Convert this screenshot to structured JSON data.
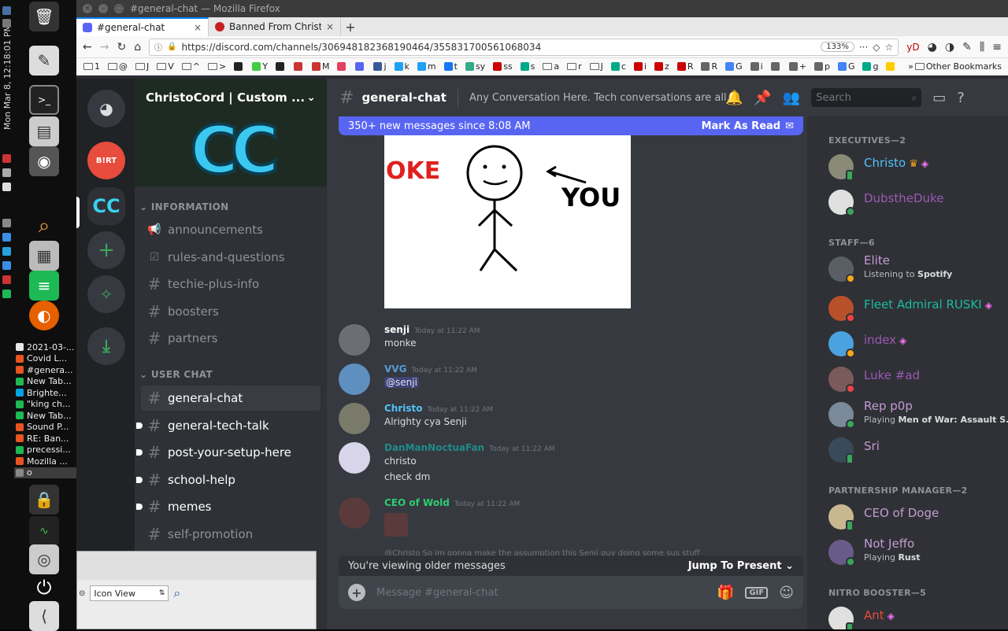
{
  "os": {
    "clock": "Mon Mar 8, 12:18:01 PM",
    "tasks": [
      {
        "label": "2021-03-...",
        "color": "#e8e8e8"
      },
      {
        "label": "Covid L...",
        "color": "#e95420"
      },
      {
        "label": "#genera...",
        "color": "#e95420"
      },
      {
        "label": "New Tab...",
        "color": "#1db954"
      },
      {
        "label": "Brighte...",
        "color": "#00a3e0"
      },
      {
        "label": "\"king ch...",
        "color": "#1db954"
      },
      {
        "label": "New Tab...",
        "color": "#1db954"
      },
      {
        "label": "Sound P...",
        "color": "#e95420"
      },
      {
        "label": "RE: Ban...",
        "color": "#e95420"
      },
      {
        "label": "precessi...",
        "color": "#1db954"
      },
      {
        "label": "Mozilla ...",
        "color": "#e95420"
      },
      {
        "label": "o",
        "color": "#888888"
      }
    ]
  },
  "firefox": {
    "title": "#general-chat — Mozilla Firefox",
    "tabs": [
      {
        "label": "#general-chat",
        "close": "×"
      },
      {
        "label": "Banned From ChristoCo",
        "close": "×"
      }
    ],
    "new_tab": "+",
    "url": "https://discord.com/channels/306948182368190464/355831700561068034",
    "zoom": "133%",
    "bookmarks": [
      "1",
      "@",
      "J",
      "V",
      "^",
      ">",
      "",
      "Y",
      "",
      "",
      "M",
      "",
      "",
      "j",
      "k",
      "m",
      "t",
      "sy",
      "ss",
      "s",
      "a",
      "r",
      "J",
      "c",
      "i",
      "z",
      "R",
      "R",
      "G",
      "i",
      "",
      "+",
      "p",
      "G",
      "g",
      ""
    ],
    "other_bookmarks": "Other Bookmarks"
  },
  "discord": {
    "server_name": "ChristoCord | Custom ...",
    "categories": {
      "information": "INFORMATION",
      "user_chat": "USER CHAT"
    },
    "info_channels": [
      {
        "name": "announcements",
        "icon": "megaphone-icon"
      },
      {
        "name": "rules-and-questions",
        "icon": "checkbox-icon"
      },
      {
        "name": "techie-plus-info",
        "icon": "hash-icon"
      },
      {
        "name": "boosters",
        "icon": "hash-icon"
      },
      {
        "name": "partners",
        "icon": "hash-icon"
      }
    ],
    "chat_channels": [
      {
        "name": "general-chat",
        "selected": true,
        "unread": false
      },
      {
        "name": "general-tech-talk",
        "selected": false,
        "unread": true
      },
      {
        "name": "post-your-setup-here",
        "selected": false,
        "unread": true
      },
      {
        "name": "school-help",
        "selected": false,
        "unread": true
      },
      {
        "name": "memes",
        "selected": false,
        "unread": true
      },
      {
        "name": "self-promotion",
        "selected": false,
        "unread": false
      }
    ],
    "channel": {
      "name": "general-chat",
      "topic": "Any Conversation Here. Tech conversations are all...",
      "search_placeholder": "Search"
    },
    "new_messages_bar": {
      "text": "350+ new messages since 8:08 AM",
      "action": "Mark As Read"
    },
    "meme": {
      "left_text": "OKE",
      "right_text": "YOU"
    },
    "messages": [
      {
        "user": "senji",
        "time": "Today at 11:22 AM",
        "lines": [
          "monke"
        ],
        "color": "#ffffff",
        "avatar": "#6b6f74"
      },
      {
        "user": "VVG",
        "time": "Today at 11:22 AM",
        "lines": [
          "@senji"
        ],
        "color": "#5b9bd5",
        "avatar": "#5f8fbf"
      },
      {
        "user": "Christo",
        "time": "Today at 11:22 AM",
        "lines": [
          "Alrighty cya Senji"
        ],
        "color": "#4fc3f7",
        "avatar": "#7a7a6a"
      },
      {
        "user": "DanManNoctuaFan",
        "time": "Today at 11:22 AM",
        "lines": [
          "christo",
          "check dm"
        ],
        "color": "#1f8b8b",
        "avatar": "#d8d4ea"
      },
      {
        "user": "CEO of Wold",
        "time": "Today at 11:22 AM",
        "lines": [
          ""
        ],
        "color": "#2ecc71",
        "avatar": "#5a3a3a"
      }
    ],
    "reply_preview": "@Christo So im gonna make the assumption this Senji guy doing some sus stuff",
    "older_bar": {
      "text": "You're viewing older messages",
      "action": "Jump To Present"
    },
    "composer_placeholder": "Message #general-chat",
    "member_groups": [
      {
        "title": "EXECUTIVES—2",
        "members": [
          {
            "name": "Christo",
            "color": "#4fc3f7",
            "badge": "crown+boost",
            "status": "mobile",
            "activity": "",
            "activity_bold": "",
            "avatar": "#8a8a78"
          },
          {
            "name": "DubstheDuke",
            "color": "#9b59b6",
            "badge": "",
            "status": "online",
            "activity": "",
            "activity_bold": "",
            "avatar": "#e0e0e0"
          }
        ]
      },
      {
        "title": "STAFF—6",
        "members": [
          {
            "name": "Elite",
            "color": "#c39bd3",
            "badge": "",
            "status": "idle",
            "activity": "Listening to ",
            "activity_bold": "Spotify",
            "avatar": "#5a5f66"
          },
          {
            "name": "Fleet Admiral RUSKI",
            "color": "#1abc9c",
            "badge": "boost",
            "status": "dnd",
            "activity": "",
            "activity_bold": "",
            "avatar": "#b8502a"
          },
          {
            "name": "index",
            "color": "#9b59b6",
            "badge": "boost",
            "status": "idle",
            "activity": "",
            "activity_bold": "",
            "avatar": "#4aa3df"
          },
          {
            "name": "Luke #ad",
            "color": "#9b59b6",
            "badge": "",
            "status": "dnd",
            "activity": "",
            "activity_bold": "",
            "avatar": "#7a5a5a"
          },
          {
            "name": "Rep p0p",
            "color": "#c39bd3",
            "badge": "",
            "status": "online",
            "activity": "Playing ",
            "activity_bold": "Men of War: Assault S...",
            "avatar": "#7a8a9a"
          },
          {
            "name": "Sri",
            "color": "#c39bd3",
            "badge": "",
            "status": "mobile",
            "activity": "",
            "activity_bold": "",
            "avatar": "#3a4a5a"
          }
        ]
      },
      {
        "title": "PARTNERSHIP MANAGER—2",
        "members": [
          {
            "name": "CEO of Doge",
            "color": "#c39bd3",
            "badge": "",
            "status": "mobile",
            "activity": "",
            "activity_bold": "",
            "avatar": "#c8b890"
          },
          {
            "name": "Not Jeffo",
            "color": "#c39bd3",
            "badge": "",
            "status": "online",
            "activity": "Playing ",
            "activity_bold": "Rust",
            "avatar": "#6a5a8a"
          }
        ]
      },
      {
        "title": "NITRO BOOSTER—5",
        "members": [
          {
            "name": "Ant",
            "color": "#e74c3c",
            "badge": "boost",
            "status": "mobile",
            "activity": "",
            "activity_bold": "",
            "avatar": "#e0e0e0"
          }
        ]
      }
    ]
  },
  "file_manager": {
    "view": "Icon View"
  }
}
